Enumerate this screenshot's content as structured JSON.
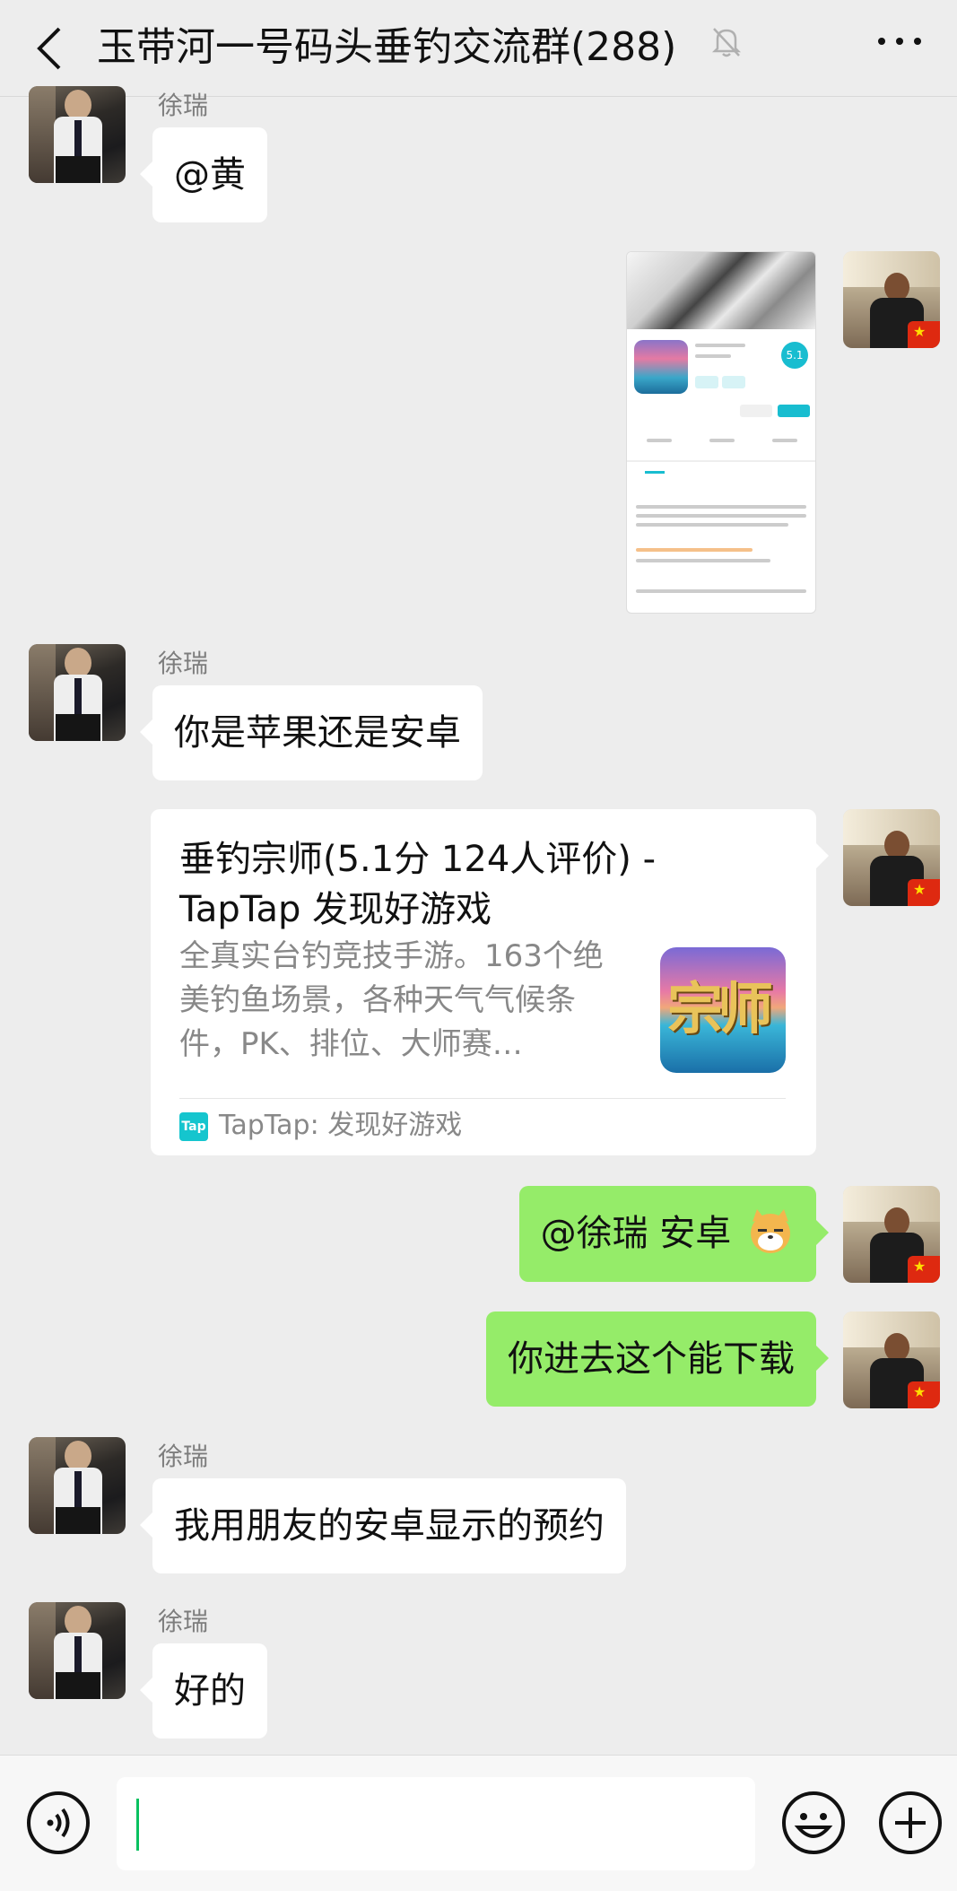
{
  "header": {
    "title": "玉带河一号码头垂钓交流群(288)",
    "back_icon": "chevron-left-icon",
    "mute_icon": "bell-off-icon",
    "more_icon": "more-dots-icon"
  },
  "messages": [
    {
      "sender": "徐瑞",
      "text": "@黄"
    },
    {
      "type": "image"
    },
    {
      "sender": "徐瑞",
      "text": "你是苹果还是安卓"
    },
    {
      "type": "link_card",
      "title": "垂钓宗师(5.1分 124人评价) - TapTap 发现好游戏",
      "description": "全真实台钓竞技手游。163个绝美钓鱼场景，各种天气气候条件，PK、排位、大师赛…",
      "icon_text": "宗师",
      "source_icon_text": "Tap",
      "source": "TapTap: 发现好游戏"
    },
    {
      "text": "@徐瑞  安卓"
    },
    {
      "text": "你进去这个能下载"
    },
    {
      "sender": "徐瑞",
      "text": "我用朋友的安卓显示的预约"
    },
    {
      "sender": "徐瑞",
      "text": "好的"
    }
  ],
  "screenshot": {
    "rating": "5.1"
  },
  "footer": {
    "input_value": "",
    "voice_icon": "voice-icon",
    "emoji_icon": "emoji-icon",
    "plus_icon": "plus-icon"
  },
  "colors": {
    "background": "#ededed",
    "self_bubble": "#95ec69",
    "other_bubble": "#ffffff",
    "caret": "#07c160"
  }
}
